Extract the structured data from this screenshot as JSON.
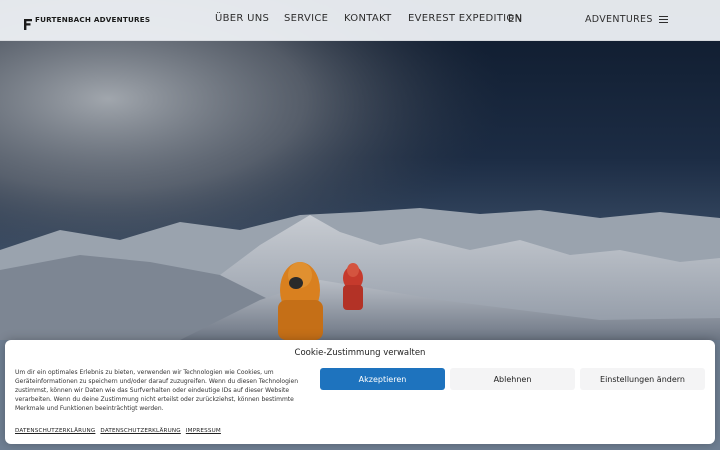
{
  "header": {
    "logo_text": "FURTENBACH ADVENTURES",
    "nav": [
      {
        "label": "ÜBER UNS"
      },
      {
        "label": "SERVICE"
      },
      {
        "label": "KONTAKT"
      },
      {
        "label": "EVEREST EXPEDITION"
      }
    ],
    "language": "EN",
    "menu_label": "ADVENTURES",
    "menu_icon": "hamburger-menu-icon"
  },
  "hero": {
    "image_subject": "mountaineers-near-everest-summit"
  },
  "cookie_banner": {
    "title": "Cookie-Zustimmung verwalten",
    "text": "Um dir ein optimales Erlebnis zu bieten, verwenden wir Technologien wie Cookies, um Geräteinformationen zu speichern und/oder darauf zuzugreifen. Wenn du diesen Technologien zustimmst, können wir Daten wie das Surfverhalten oder eindeutige IDs auf dieser Website verarbeiten. Wenn du deine Zustimmung nicht erteilst oder zurückziehst, können bestimmte Merkmale und Funktionen beeinträchtigt werden.",
    "accept_label": "Akzeptieren",
    "deny_label": "Ablehnen",
    "settings_label": "Einstellungen ändern",
    "links": [
      "DATENSCHUTZERKLÄRUNG",
      "DATENSCHUTZERKLÄRUNG",
      "IMPRESSUM"
    ],
    "accent_color": "#1e73be"
  }
}
